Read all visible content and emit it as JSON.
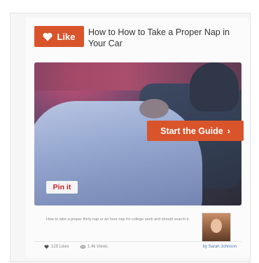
{
  "like_button": {
    "label": "Like",
    "icon": "heart-icon"
  },
  "guide": {
    "title": "How to How to Take a Proper Nap in Your Car"
  },
  "hero": {
    "start_label": "Start the Guide",
    "start_icon": "arrow-right-icon",
    "pin_label": "Pin it"
  },
  "description": "How to take a proper thirty nap or an hour nap for college work and should search it.",
  "stats": {
    "likes": "128 Likes",
    "views": "1.4k Views",
    "byline": "by Sarah Johnson"
  },
  "colors": {
    "accent": "#d9542b",
    "link": "#4a78b8",
    "pinterest": "#cb2027"
  }
}
